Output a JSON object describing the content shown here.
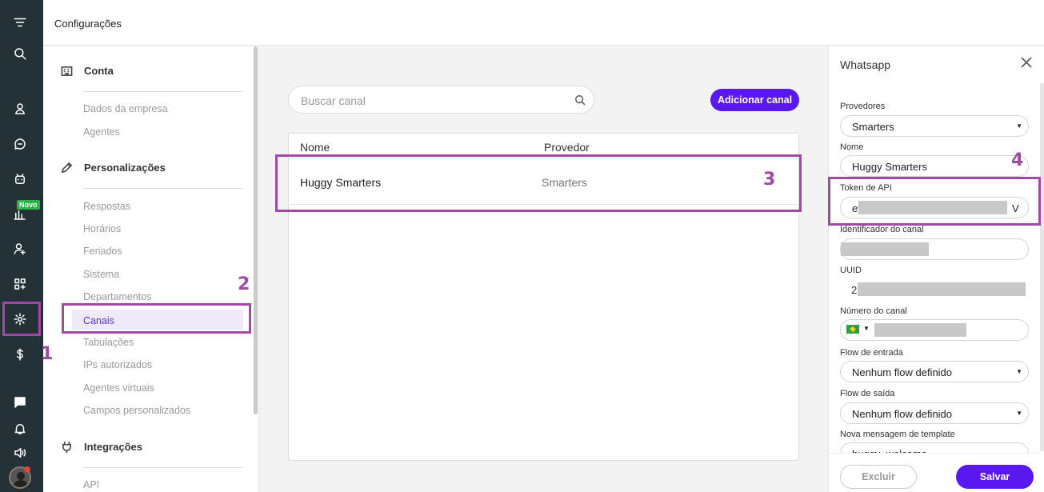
{
  "topbar": {
    "title": "Configurações"
  },
  "rail": {
    "icons": [
      "menu-icon",
      "search-icon",
      "contacts-icon",
      "chat-icon",
      "bot-icon",
      "reports-icon",
      "agents-icon",
      "apps-icon",
      "settings-icon",
      "billing-icon",
      "messages-icon",
      "bell-icon",
      "sound-icon"
    ],
    "novo_badge": "Novo"
  },
  "menu": {
    "conta": {
      "label": "Conta",
      "items": [
        "Dados da empresa",
        "Agentes"
      ]
    },
    "personalizacoes": {
      "label": "Personalizações",
      "items": [
        "Respostas",
        "Horários",
        "Feriados",
        "Sistema",
        "Departamentos",
        "Canais",
        "Tabulações",
        "IPs autorizados",
        "Agentes virtuais",
        "Campos personalizados"
      ]
    },
    "integracoes": {
      "label": "Integrações",
      "items": [
        "API"
      ]
    }
  },
  "main": {
    "search_placeholder": "Buscar canal",
    "add_button": "Adicionar canal",
    "columns": [
      "Nome",
      "Provedor"
    ],
    "rows": [
      {
        "nome": "Huggy Smarters",
        "provedor": "Smarters"
      }
    ]
  },
  "panel": {
    "title": "Whatsapp",
    "fields": {
      "provedores": {
        "label": "Provedores",
        "value": "Smarters"
      },
      "nome": {
        "label": "Nome",
        "value": "Huggy Smarters"
      },
      "token": {
        "label": "Token de API",
        "prefix": "ey",
        "suffix": "V"
      },
      "identificador": {
        "label": "Identificador do canal"
      },
      "uuid": {
        "label": "UUID",
        "prefix": "2"
      },
      "numero": {
        "label": "Número do canal"
      },
      "flow_entrada": {
        "label": "Flow de entrada",
        "value": "Nenhum flow definido"
      },
      "flow_saida": {
        "label": "Flow de saída",
        "value": "Nenhum flow definido"
      },
      "template": {
        "label": "Nova mensagem de template",
        "value": "huggy_welcome"
      }
    },
    "delete_button": "Excluir",
    "save_button": "Salvar"
  },
  "annotations": [
    "1",
    "2",
    "3",
    "4"
  ],
  "colors": {
    "accent": "#5a18f0",
    "annotation": "#a04aa6",
    "rail": "#243238"
  }
}
